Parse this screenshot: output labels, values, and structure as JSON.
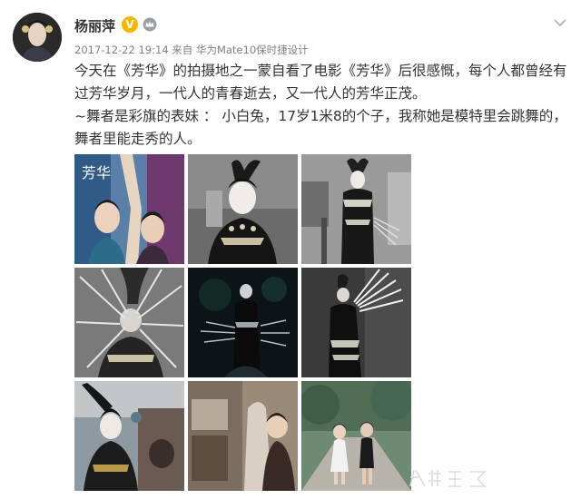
{
  "post": {
    "username": "杨丽萍",
    "verified_badge": "V",
    "member_icon": "vip-crown-icon",
    "timestamp": "2017-12-22 19:14",
    "source_prefix": "来自",
    "source_device": "华为Mate10保时捷设计",
    "more_icon": "chevron-down-icon",
    "text_line1": "今天在《芳华》的拍摄地之一蒙自看了电影《芳华》后很感慨，每个人都曾经有",
    "text_line2": "过芳华岁月，一代人的青春逝去，又一代人的芳华正茂。",
    "text_line3": "~舞者是彩旗的表妹 ： 小白兔，17岁1米8的个子，我称她是模特里会跳舞的，",
    "text_line4": "舞者里能走秀的人。",
    "photos": [
      {
        "name": "poster-dancers-photo",
        "text": "芳华"
      },
      {
        "name": "headdress-portrait-photo"
      },
      {
        "name": "silver-costume-photo"
      },
      {
        "name": "spike-collar-photo"
      },
      {
        "name": "dark-stage-photo"
      },
      {
        "name": "claw-hands-photo"
      },
      {
        "name": "horned-headdress-photo"
      },
      {
        "name": "mother-daughter-photo"
      },
      {
        "name": "two-girls-park-photo"
      }
    ]
  },
  "colors": {
    "text": "#333333",
    "meta": "#808080",
    "badge": "#f7b500"
  }
}
